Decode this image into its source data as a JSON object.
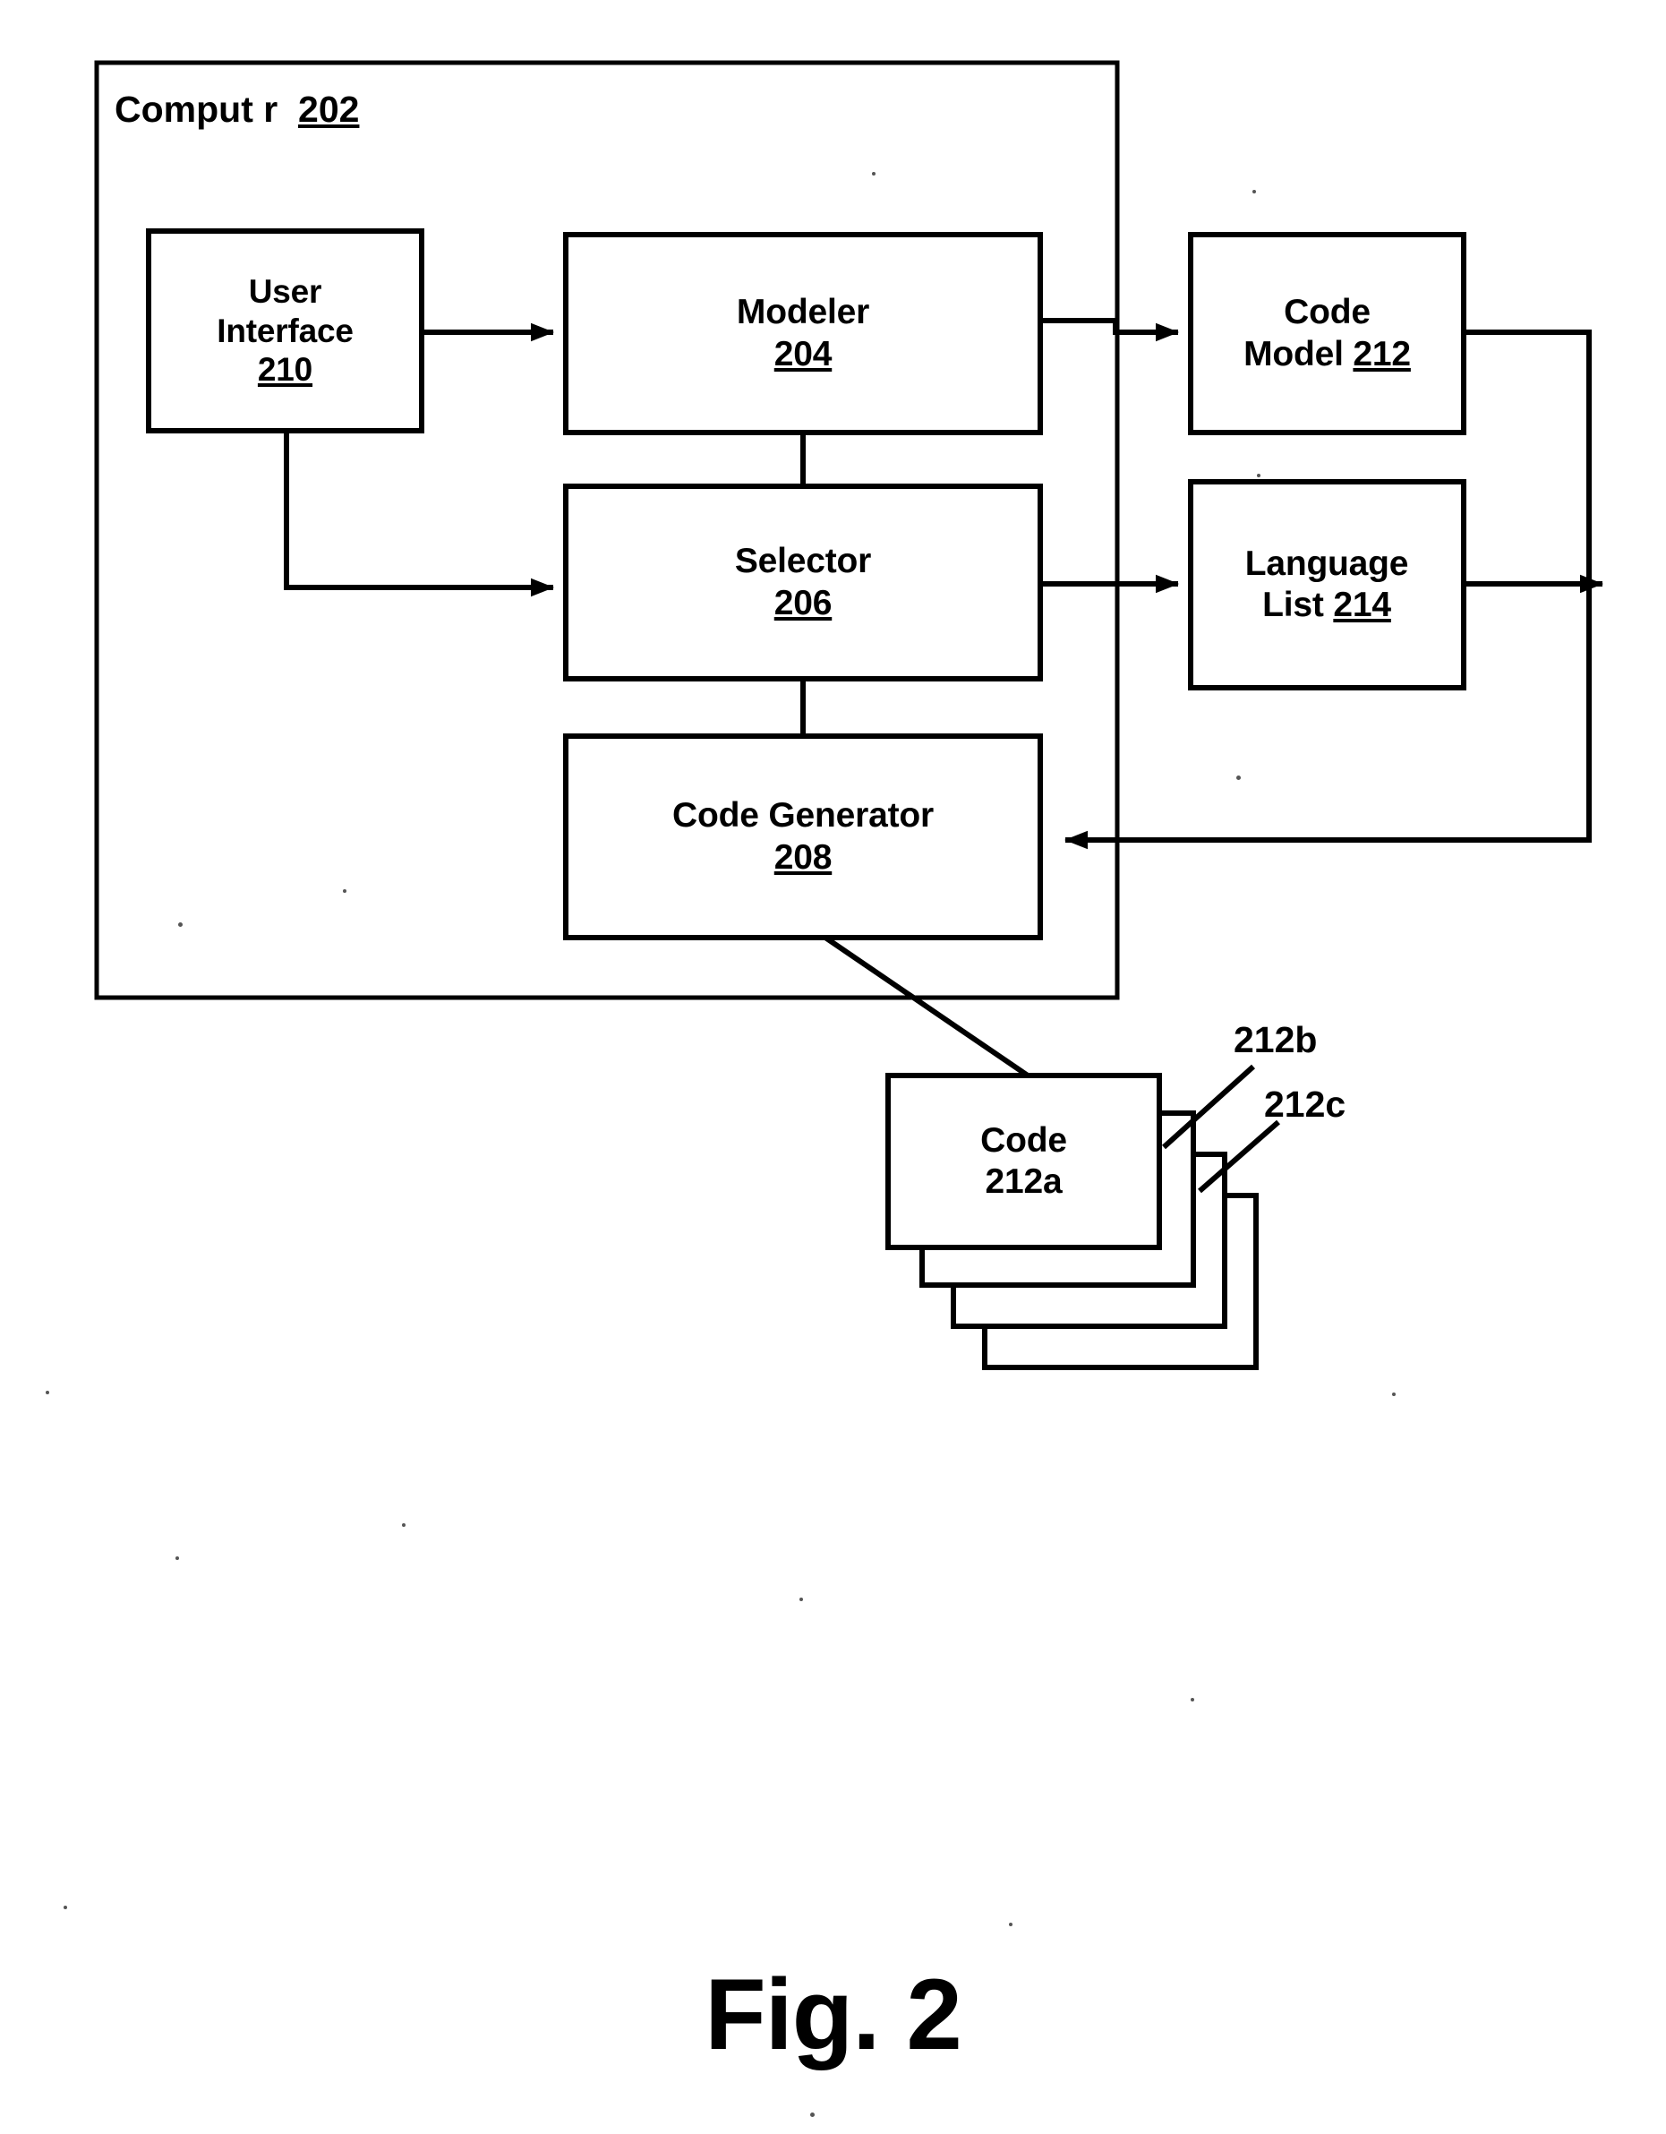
{
  "figure": {
    "caption": "Fig. 2",
    "container": {
      "title_text": "Comput  r",
      "title_ref": "202"
    },
    "boxes": [
      {
        "name": "user-interface",
        "line1": "User",
        "line2": "Interface",
        "ref": "210"
      },
      {
        "name": "modeler",
        "line1": "Modeler",
        "line2": "",
        "ref": "204"
      },
      {
        "name": "selector",
        "line1": "Selector",
        "line2": "",
        "ref": "206"
      },
      {
        "name": "code-generator",
        "line1": "Code Generator",
        "line2": "",
        "ref": "208"
      },
      {
        "name": "code-model",
        "line1": "Code",
        "line2": "Model",
        "ref": "212"
      },
      {
        "name": "language-list",
        "line1": "Language",
        "line2": "List",
        "ref": "214"
      }
    ],
    "code_stack": {
      "front_line1": "Code",
      "front_line2": "212a",
      "callout_b": "212b",
      "callout_c": "212c"
    },
    "colors": {
      "ink": "#000000",
      "paper": "#ffffff"
    }
  }
}
